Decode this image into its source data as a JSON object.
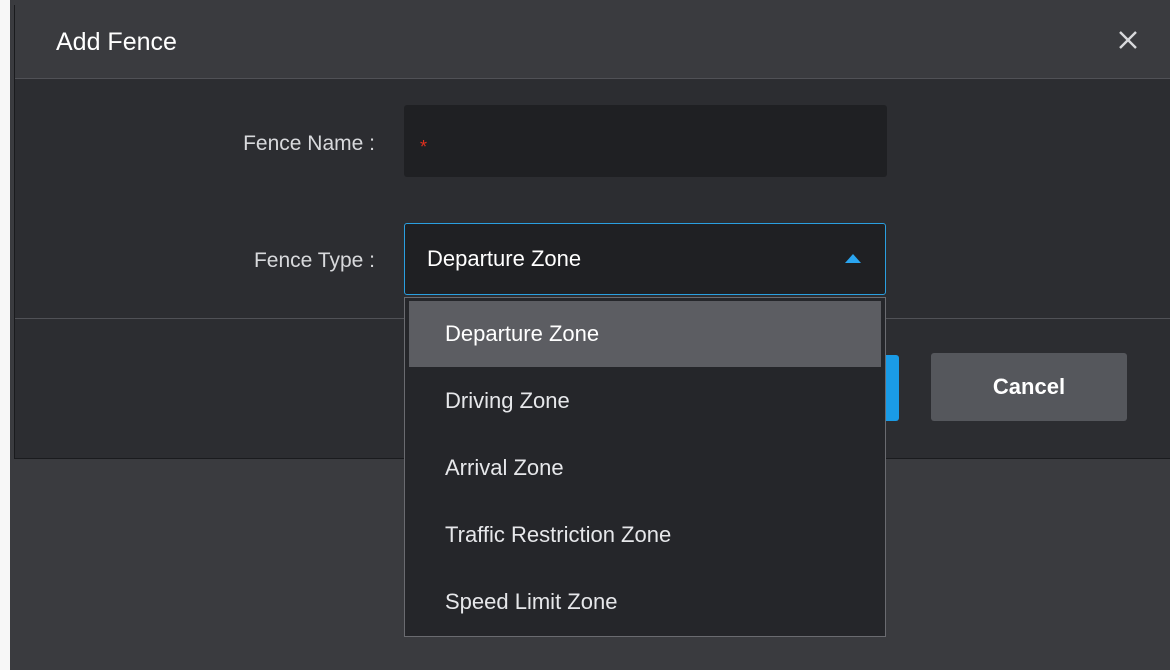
{
  "dialog": {
    "title": "Add Fence",
    "close_icon": "close-icon"
  },
  "form": {
    "name_label": "Fence Name :",
    "name_value": "",
    "required_marker": "*",
    "type_label": "Fence Type :",
    "type_value": "Departure Zone"
  },
  "dropdown": {
    "options": [
      "Departure Zone",
      "Driving Zone",
      "Arrival Zone",
      "Traffic Restriction Zone",
      "Speed Limit Zone"
    ],
    "selected_index": 0
  },
  "buttons": {
    "cancel_label": "Cancel"
  },
  "colors": {
    "accent": "#1a9be6",
    "required": "#e0301e",
    "dialog_bg": "#2c2d31",
    "header_bg": "#3a3b3f"
  }
}
